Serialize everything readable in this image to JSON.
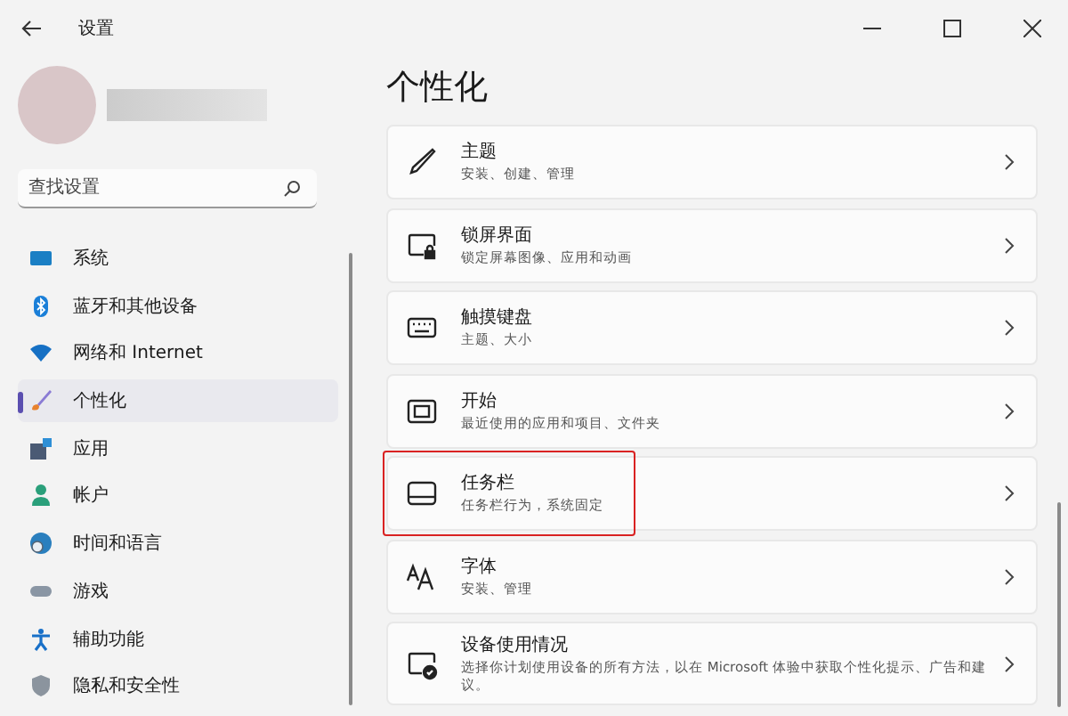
{
  "window": {
    "title": "设置"
  },
  "search": {
    "placeholder": "查找设置"
  },
  "sidebar": {
    "items": [
      {
        "label": "系统",
        "selected": false
      },
      {
        "label": "蓝牙和其他设备",
        "selected": false
      },
      {
        "label": "网络和 Internet",
        "selected": false
      },
      {
        "label": "个性化",
        "selected": true
      },
      {
        "label": "应用",
        "selected": false
      },
      {
        "label": "帐户",
        "selected": false
      },
      {
        "label": "时间和语言",
        "selected": false
      },
      {
        "label": "游戏",
        "selected": false
      },
      {
        "label": "辅助功能",
        "selected": false
      },
      {
        "label": "隐私和安全性",
        "selected": false
      }
    ]
  },
  "page": {
    "title": "个性化",
    "items": [
      {
        "title": "主题",
        "description": "安装、创建、管理",
        "highlighted": false
      },
      {
        "title": "锁屏界面",
        "description": "锁定屏幕图像、应用和动画",
        "highlighted": false
      },
      {
        "title": "触摸键盘",
        "description": "主题、大小",
        "highlighted": false
      },
      {
        "title": "开始",
        "description": "最近使用的应用和项目、文件夹",
        "highlighted": false
      },
      {
        "title": "任务栏",
        "description": "任务栏行为，系统固定",
        "highlighted": true
      },
      {
        "title": "字体",
        "description": "安装、管理",
        "highlighted": false
      },
      {
        "title": "设备使用情况",
        "description": "选择你计划使用设备的所有方法，以在 Microsoft 体验中获取个性化提示、广告和建议。",
        "highlighted": false
      }
    ]
  }
}
